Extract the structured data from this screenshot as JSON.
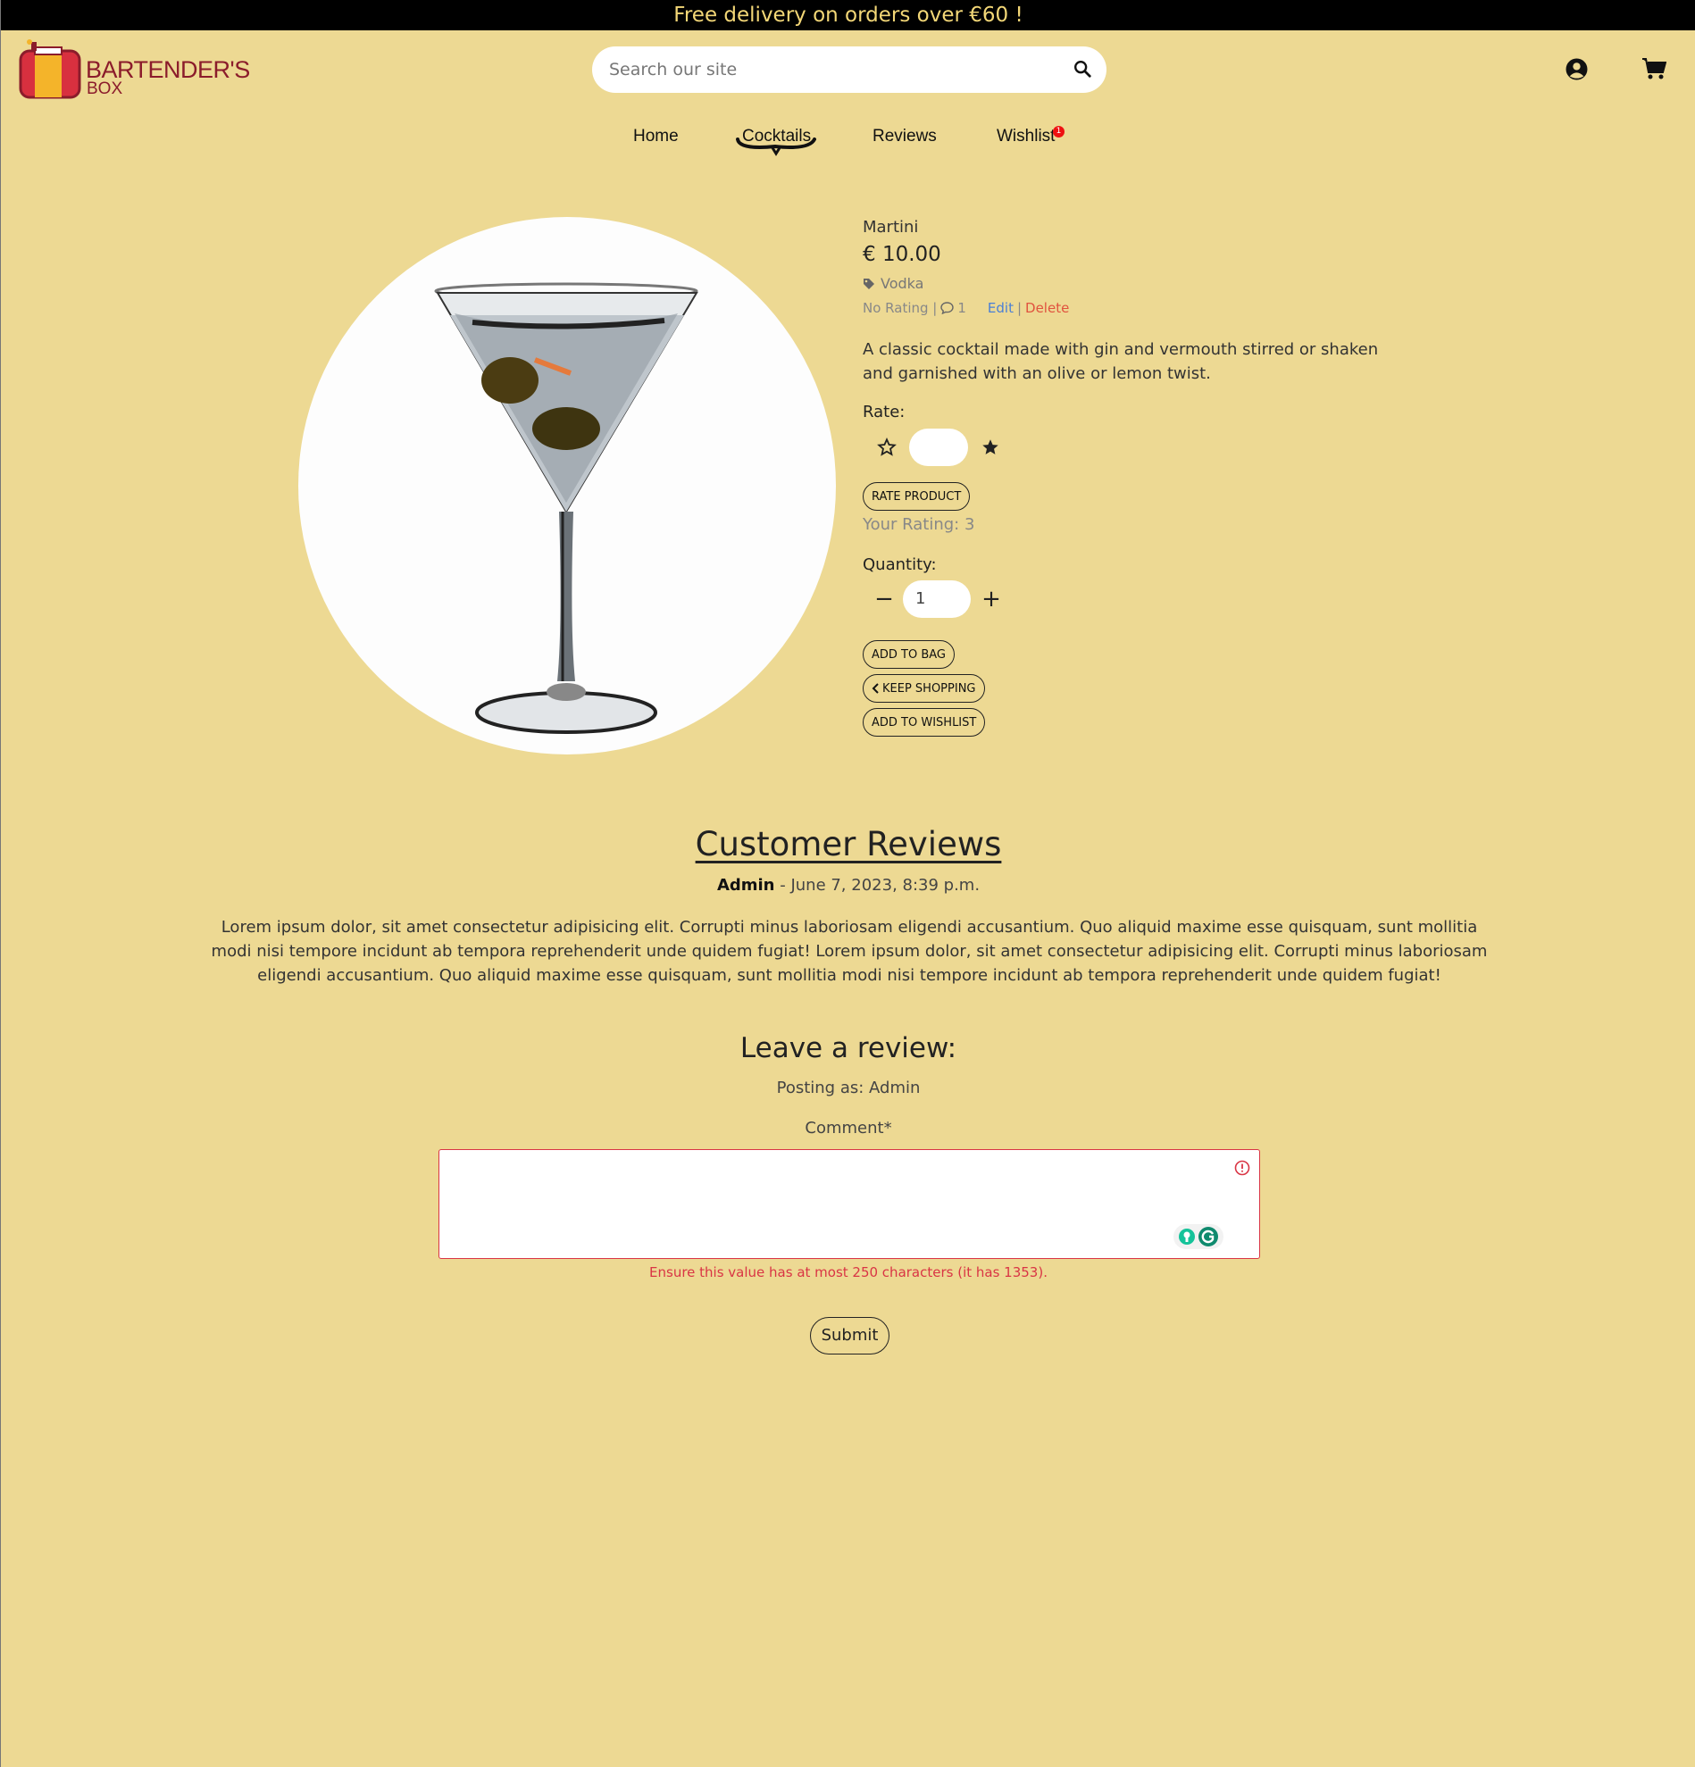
{
  "banner": {
    "text": "Free delivery on orders over €60 !"
  },
  "brand": {
    "name_line1": "BARTENDER'S",
    "name_line2": "BOX"
  },
  "search": {
    "placeholder": "Search our site"
  },
  "nav": {
    "items": [
      {
        "label": "Home"
      },
      {
        "label": "Cocktails",
        "active": true
      },
      {
        "label": "Reviews"
      },
      {
        "label": "Wishlist",
        "badge": "1"
      }
    ]
  },
  "product": {
    "name": "Martini",
    "price": "€ 10.00",
    "category": "Vodka",
    "rating_text": "No Rating |",
    "comments_count": "1",
    "edit_label": "Edit",
    "separator": "|",
    "delete_label": "Delete",
    "description": "A classic cocktail made with gin and vermouth stirred or shaken and garnished with an olive or lemon twist."
  },
  "rate": {
    "label": "Rate:",
    "button": "RATE PRODUCT",
    "your_rating": "Your Rating: 3"
  },
  "quantity": {
    "label": "Quantity:",
    "value": "1",
    "minus": "−",
    "plus": "+"
  },
  "actions": {
    "add_to_bag": "ADD TO BAG",
    "keep_shopping": "KEEP SHOPPING",
    "add_to_wishlist": "ADD TO WISHLIST"
  },
  "reviews": {
    "title": "Customer Reviews",
    "items": [
      {
        "author": "Admin",
        "date": " - June 7, 2023, 8:39 p.m.",
        "text": "Lorem ipsum dolor, sit amet consectetur adipisicing elit. Corrupti minus laboriosam eligendi accusantium. Quo aliquid maxime esse quisquam, sunt mollitia modi nisi tempore incidunt ab tempora reprehenderit unde quidem fugiat! Lorem ipsum dolor, sit amet consectetur adipisicing elit. Corrupti minus laboriosam eligendi accusantium. Quo aliquid maxime esse quisquam, sunt mollitia modi nisi tempore incidunt ab tempora reprehenderit unde quidem fugiat!"
      }
    ]
  },
  "review_form": {
    "title": "Leave a review:",
    "posting_as": "Posting as: Admin",
    "comment_label": "Comment*",
    "error": "Ensure this value has at most 250 characters (it has 1353).",
    "submit": "Submit"
  },
  "colors": {
    "background": "#edd993",
    "banner_text": "#f3d777",
    "brand": "#8b1c2b",
    "error": "#d93545",
    "edit_link": "#4a7fd6",
    "delete_link": "#e0533f"
  }
}
